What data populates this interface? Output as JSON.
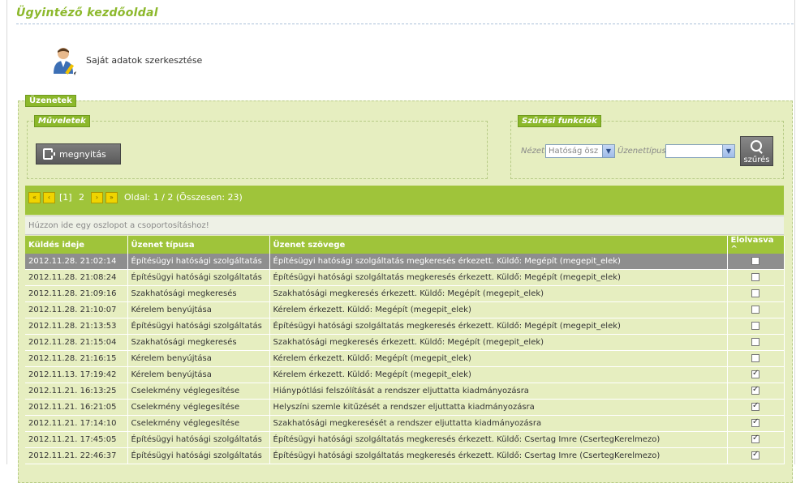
{
  "page": {
    "title": "Ügyintéző kezdőoldal"
  },
  "profile": {
    "edit_label": "Saját adatok szerkesztése",
    "icon": "user-edit-icon"
  },
  "messages": {
    "legend": "Üzenetek",
    "operations": {
      "legend": "Műveletek",
      "open_button": "megnyitás"
    },
    "filter": {
      "legend": "Szűrési funkciók",
      "view_label": "Nézet",
      "view_value": "Hatóság ösz",
      "type_label": "Üzenettípus",
      "type_value": "",
      "search_button": "szűrés"
    },
    "pager": {
      "first": "«",
      "prev": "‹",
      "pages": "[1]",
      "page2": "2",
      "next": "›",
      "last": "»",
      "info": "Oldal: 1 / 2 (Összesen: 23)"
    },
    "group_hint": "Húzzon ide egy oszlopot a csoportosításhoz!",
    "columns": [
      "Küldés ideje",
      "Üzenet típusa",
      "Üzenet szövege",
      "Elolvasva ^"
    ],
    "rows": [
      {
        "time": "2012.11.28. 21:02:14",
        "type": "Építésügyi hatósági szolgáltatás",
        "text": "Építésügyi hatósági szolgáltatás megkeresés érkezett. Küldő: Megépít (megepit_elek)",
        "read": false
      },
      {
        "time": "2012.11.28. 21:08:24",
        "type": "Építésügyi hatósági szolgáltatás",
        "text": "Építésügyi hatósági szolgáltatás megkeresés érkezett. Küldő: Megépít (megepit_elek)",
        "read": false
      },
      {
        "time": "2012.11.28. 21:09:16",
        "type": "Szakhatósági megkeresés",
        "text": "Szakhatósági megkeresés érkezett. Küldő: Megépít (megepit_elek)",
        "read": false
      },
      {
        "time": "2012.11.28. 21:10:07",
        "type": "Kérelem benyújtása",
        "text": "Kérelem érkezett. Küldő: Megépít (megepit_elek)",
        "read": false
      },
      {
        "time": "2012.11.28. 21:13:53",
        "type": "Építésügyi hatósági szolgáltatás",
        "text": "Építésügyi hatósági szolgáltatás megkeresés érkezett. Küldő: Megépít (megepit_elek)",
        "read": false
      },
      {
        "time": "2012.11.28. 21:15:04",
        "type": "Szakhatósági megkeresés",
        "text": "Szakhatósági megkeresés érkezett. Küldő: Megépít (megepit_elek)",
        "read": false
      },
      {
        "time": "2012.11.28. 21:16:15",
        "type": "Kérelem benyújtása",
        "text": "Kérelem érkezett. Küldő: Megépít (megepit_elek)",
        "read": false
      },
      {
        "time": "2012.11.13. 17:19:42",
        "type": "Kérelem benyújtása",
        "text": "Kérelem érkezett. Küldő: Megépít (megepit_elek)",
        "read": true
      },
      {
        "time": "2012.11.21. 16:13:25",
        "type": "Cselekmény véglegesítése",
        "text": "Hiánypótlási felszólítását a rendszer eljuttatta kiadmányozásra",
        "read": true
      },
      {
        "time": "2012.11.21. 16:21:05",
        "type": "Cselekmény véglegesítése",
        "text": "Helyszíni szemle kitűzését a rendszer eljuttatta kiadmányozásra",
        "read": true
      },
      {
        "time": "2012.11.21. 17:14:10",
        "type": "Cselekmény véglegesítése",
        "text": "Szakhatósági megkeresését a rendszer eljuttatta kiadmányozásra",
        "read": true
      },
      {
        "time": "2012.11.21. 17:45:05",
        "type": "Építésügyi hatósági szolgáltatás",
        "text": "Építésügyi hatósági szolgáltatás megkeresés érkezett. Küldő: Csertag Imre (CsertegKerelmezo)",
        "read": true
      },
      {
        "time": "2012.11.21. 22:46:37",
        "type": "Építésügyi hatósági szolgáltatás",
        "text": "Építésügyi hatósági szolgáltatás megkeresés érkezett. Küldő: Csertag Imre (CsertegKerelmezo)",
        "read": true
      }
    ]
  },
  "colors": {
    "accent_green": "#9fc43a",
    "panel_bg": "#e6eec0",
    "title_green": "#8cb82b",
    "selected_row": "#8e8e8e"
  }
}
